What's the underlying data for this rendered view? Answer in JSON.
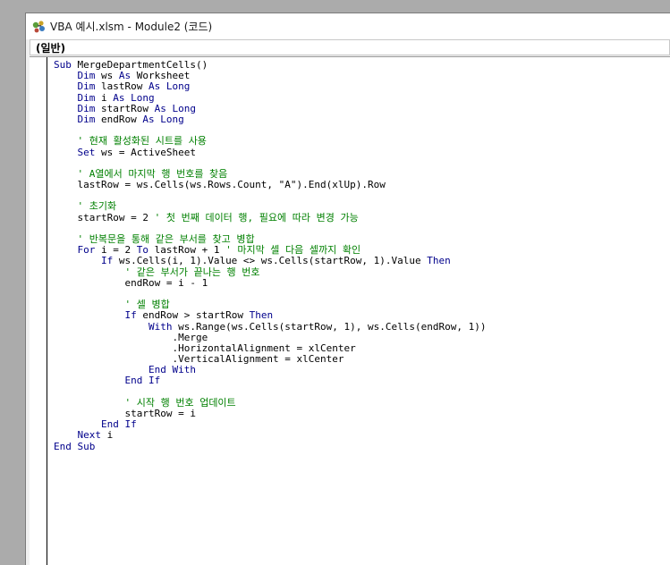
{
  "window": {
    "title": "VBA 예시.xlsm - Module2 (코드)",
    "icon": "vba-project-icon"
  },
  "object_selector": {
    "selected": "(일반)"
  },
  "code_lines": [
    [
      {
        "t": "kw",
        "v": "Sub"
      },
      {
        "t": "tx",
        "v": " MergeDepartmentCells()"
      }
    ],
    [
      {
        "t": "tx",
        "v": "    "
      },
      {
        "t": "kw",
        "v": "Dim"
      },
      {
        "t": "tx",
        "v": " ws "
      },
      {
        "t": "kw",
        "v": "As"
      },
      {
        "t": "tx",
        "v": " Worksheet"
      }
    ],
    [
      {
        "t": "tx",
        "v": "    "
      },
      {
        "t": "kw",
        "v": "Dim"
      },
      {
        "t": "tx",
        "v": " lastRow "
      },
      {
        "t": "kw",
        "v": "As Long"
      }
    ],
    [
      {
        "t": "tx",
        "v": "    "
      },
      {
        "t": "kw",
        "v": "Dim"
      },
      {
        "t": "tx",
        "v": " i "
      },
      {
        "t": "kw",
        "v": "As Long"
      }
    ],
    [
      {
        "t": "tx",
        "v": "    "
      },
      {
        "t": "kw",
        "v": "Dim"
      },
      {
        "t": "tx",
        "v": " startRow "
      },
      {
        "t": "kw",
        "v": "As Long"
      }
    ],
    [
      {
        "t": "tx",
        "v": "    "
      },
      {
        "t": "kw",
        "v": "Dim"
      },
      {
        "t": "tx",
        "v": " endRow "
      },
      {
        "t": "kw",
        "v": "As Long"
      }
    ],
    [],
    [
      {
        "t": "tx",
        "v": "    "
      },
      {
        "t": "cm",
        "v": "' 현재 활성화된 시트를 사용"
      }
    ],
    [
      {
        "t": "tx",
        "v": "    "
      },
      {
        "t": "kw",
        "v": "Set"
      },
      {
        "t": "tx",
        "v": " ws = ActiveSheet"
      }
    ],
    [],
    [
      {
        "t": "tx",
        "v": "    "
      },
      {
        "t": "cm",
        "v": "' A열에서 마지막 행 번호를 찾음"
      }
    ],
    [
      {
        "t": "tx",
        "v": "    lastRow = ws.Cells(ws.Rows.Count, \"A\").End(xlUp).Row"
      }
    ],
    [],
    [
      {
        "t": "tx",
        "v": "    "
      },
      {
        "t": "cm",
        "v": "' 초기화"
      }
    ],
    [
      {
        "t": "tx",
        "v": "    startRow = 2 "
      },
      {
        "t": "cm",
        "v": "' 첫 번째 데이터 행, 필요에 따라 변경 가능"
      }
    ],
    [],
    [
      {
        "t": "tx",
        "v": "    "
      },
      {
        "t": "cm",
        "v": "' 반복문을 통해 같은 부서를 찾고 병합"
      }
    ],
    [
      {
        "t": "tx",
        "v": "    "
      },
      {
        "t": "kw",
        "v": "For"
      },
      {
        "t": "tx",
        "v": " i = 2 "
      },
      {
        "t": "kw",
        "v": "To"
      },
      {
        "t": "tx",
        "v": " lastRow + 1 "
      },
      {
        "t": "cm",
        "v": "' 마지막 셀 다음 셀까지 확인"
      }
    ],
    [
      {
        "t": "tx",
        "v": "        "
      },
      {
        "t": "kw",
        "v": "If"
      },
      {
        "t": "tx",
        "v": " ws.Cells(i, 1).Value <> ws.Cells(startRow, 1).Value "
      },
      {
        "t": "kw",
        "v": "Then"
      }
    ],
    [
      {
        "t": "tx",
        "v": "            "
      },
      {
        "t": "cm",
        "v": "' 같은 부서가 끝나는 행 번호"
      }
    ],
    [
      {
        "t": "tx",
        "v": "            endRow = i - 1"
      }
    ],
    [],
    [
      {
        "t": "tx",
        "v": "            "
      },
      {
        "t": "cm",
        "v": "' 셀 병합"
      }
    ],
    [
      {
        "t": "tx",
        "v": "            "
      },
      {
        "t": "kw",
        "v": "If"
      },
      {
        "t": "tx",
        "v": " endRow > startRow "
      },
      {
        "t": "kw",
        "v": "Then"
      }
    ],
    [
      {
        "t": "tx",
        "v": "                "
      },
      {
        "t": "kw",
        "v": "With"
      },
      {
        "t": "tx",
        "v": " ws.Range(ws.Cells(startRow, 1), ws.Cells(endRow, 1))"
      }
    ],
    [
      {
        "t": "tx",
        "v": "                    .Merge"
      }
    ],
    [
      {
        "t": "tx",
        "v": "                    .HorizontalAlignment = xlCenter"
      }
    ],
    [
      {
        "t": "tx",
        "v": "                    .VerticalAlignment = xlCenter"
      }
    ],
    [
      {
        "t": "tx",
        "v": "                "
      },
      {
        "t": "kw",
        "v": "End With"
      }
    ],
    [
      {
        "t": "tx",
        "v": "            "
      },
      {
        "t": "kw",
        "v": "End If"
      }
    ],
    [],
    [
      {
        "t": "tx",
        "v": "            "
      },
      {
        "t": "cm",
        "v": "' 시작 행 번호 업데이트"
      }
    ],
    [
      {
        "t": "tx",
        "v": "            startRow = i"
      }
    ],
    [
      {
        "t": "tx",
        "v": "        "
      },
      {
        "t": "kw",
        "v": "End If"
      }
    ],
    [
      {
        "t": "tx",
        "v": "    "
      },
      {
        "t": "kw",
        "v": "Next"
      },
      {
        "t": "tx",
        "v": " i"
      }
    ],
    [
      {
        "t": "kw",
        "v": "End Sub"
      }
    ]
  ],
  "colors": {
    "keyword": "#00008b",
    "comment": "#008000",
    "text": "#000000",
    "desktop": "#ababab"
  }
}
